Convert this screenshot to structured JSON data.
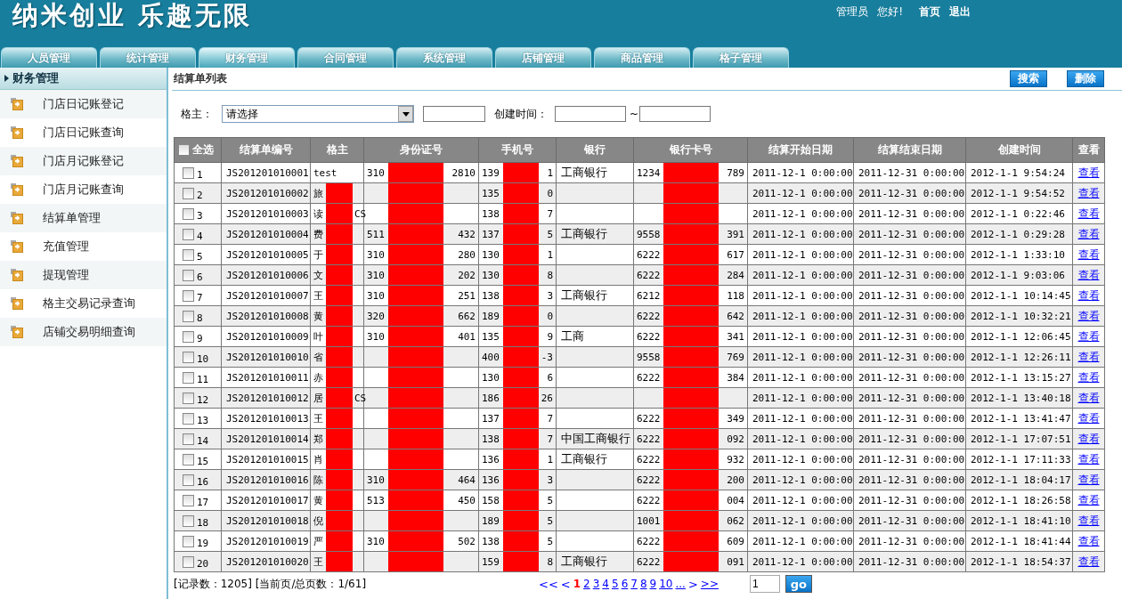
{
  "header": {
    "title": "纳米创业 乐趣无限",
    "user_label": "管理员",
    "greeting": "您好!",
    "links": [
      "首页",
      "退出"
    ]
  },
  "tabs": [
    {
      "label": "人员管理",
      "selected": false
    },
    {
      "label": "统计管理",
      "selected": false
    },
    {
      "label": "财务管理",
      "selected": true
    },
    {
      "label": "合同管理",
      "selected": false
    },
    {
      "label": "系统管理",
      "selected": false
    },
    {
      "label": "店铺管理",
      "selected": false
    },
    {
      "label": "商品管理",
      "selected": false
    },
    {
      "label": "格子管理",
      "selected": false
    }
  ],
  "sidebar": {
    "heading": "财务管理",
    "items": [
      {
        "label": "门店日记账登记",
        "selected": false
      },
      {
        "label": "门店日记账查询",
        "selected": false
      },
      {
        "label": "门店月记账登记",
        "selected": false
      },
      {
        "label": "门店月记账查询",
        "selected": false
      },
      {
        "label": "结算单管理",
        "selected": false
      },
      {
        "label": "充值管理",
        "selected": false
      },
      {
        "label": "提现管理",
        "selected": false
      },
      {
        "label": "格主交易记录查询",
        "selected": false
      },
      {
        "label": "店铺交易明细查询",
        "selected": false
      }
    ]
  },
  "panel": {
    "title": "结算单列表",
    "buttons": [
      "搜索",
      "删除"
    ]
  },
  "filters": {
    "owner_label": "格主：",
    "owner_select": "请选择",
    "created_label": "创建时间：",
    "range_separator": "~"
  },
  "table": {
    "select_all": {
      "label": "全选",
      "checked": false
    },
    "columns": [
      "结算单编号",
      "格主",
      "身份证号",
      "手机号",
      "银行",
      "银行卡号",
      "结算开始日期",
      "结算结束日期",
      "创建时间",
      "查看"
    ],
    "rows": [
      {
        "no": "1",
        "checked": false,
        "code": "JS201201010001",
        "owner": {
          "start": "test",
          "redacted": false
        },
        "id_card": {
          "start": "310",
          "end": "2810",
          "redacted": true
        },
        "phone": {
          "start": "139",
          "end": "1",
          "redacted": true
        },
        "bank": "工商银行",
        "card": {
          "start": "1234",
          "end": "789",
          "redacted": true
        },
        "start": "2011-12-1 0:00:00",
        "end": "2011-12-31 0:00:00",
        "created": "2012-1-1 9:54:24",
        "view": "查看"
      },
      {
        "no": "2",
        "checked": false,
        "code": "JS201201010002",
        "owner": {
          "start": "旅",
          "redacted": true
        },
        "id_card": {
          "redacted": true
        },
        "phone": {
          "start": "135",
          "end": "0",
          "redacted": true
        },
        "card": {
          "redacted": true
        },
        "start": "2011-12-1 0:00:00",
        "end": "2011-12-31 0:00:00",
        "created": "2012-1-1 9:54:52",
        "view": "查看"
      },
      {
        "no": "3",
        "checked": false,
        "code": "JS201201010003",
        "owner": {
          "start": "读",
          "end": "CS",
          "redacted": true
        },
        "id_card": {
          "redacted": true
        },
        "phone": {
          "start": "138",
          "end": "7",
          "redacted": true
        },
        "card": {
          "redacted": true
        },
        "start": "2011-12-1 0:00:00",
        "end": "2011-12-31 0:00:00",
        "created": "2012-1-1 0:22:46",
        "view": "查看"
      },
      {
        "no": "4",
        "checked": false,
        "code": "JS201201010004",
        "owner": {
          "start": "费",
          "redacted": true
        },
        "id_card": {
          "start": "511",
          "end": "432",
          "redacted": true
        },
        "phone": {
          "start": "137",
          "end": "5",
          "redacted": true
        },
        "bank": "工商银行",
        "card": {
          "start": "9558",
          "end": "391",
          "redacted": true
        },
        "start": "2011-12-1 0:00:00",
        "end": "2011-12-31 0:00:00",
        "created": "2012-1-1 0:29:28",
        "view": "查看"
      },
      {
        "no": "5",
        "checked": false,
        "code": "JS201201010005",
        "owner": {
          "start": "于",
          "redacted": true
        },
        "id_card": {
          "start": "310",
          "end": "280",
          "redacted": true
        },
        "phone": {
          "start": "130",
          "end": "1",
          "redacted": true
        },
        "card": {
          "start": "6222",
          "end": "617",
          "redacted": true
        },
        "start": "2011-12-1 0:00:00",
        "end": "2011-12-31 0:00:00",
        "created": "2012-1-1 1:33:10",
        "view": "查看"
      },
      {
        "no": "6",
        "checked": false,
        "code": "JS201201010006",
        "owner": {
          "start": "文",
          "redacted": true
        },
        "id_card": {
          "start": "310",
          "end": "202",
          "redacted": true
        },
        "phone": {
          "start": "130",
          "end": "8",
          "redacted": true
        },
        "card": {
          "start": "6222",
          "end": "284",
          "redacted": true
        },
        "start": "2011-12-1 0:00:00",
        "end": "2011-12-31 0:00:00",
        "created": "2012-1-1 9:03:06",
        "view": "查看"
      },
      {
        "no": "7",
        "checked": false,
        "code": "JS201201010007",
        "owner": {
          "start": "王",
          "redacted": true
        },
        "id_card": {
          "start": "310",
          "end": "251",
          "redacted": true
        },
        "phone": {
          "start": "138",
          "end": "3",
          "redacted": true
        },
        "bank": "工商银行",
        "card": {
          "start": "6212",
          "end": "118",
          "redacted": true
        },
        "start": "2011-12-1 0:00:00",
        "end": "2011-12-31 0:00:00",
        "created": "2012-1-1 10:14:45",
        "view": "查看"
      },
      {
        "no": "8",
        "checked": false,
        "code": "JS201201010008",
        "owner": {
          "start": "黄",
          "redacted": true
        },
        "id_card": {
          "start": "320",
          "end": "662",
          "redacted": true
        },
        "phone": {
          "start": "189",
          "end": "0",
          "redacted": true
        },
        "card": {
          "start": "6222",
          "end": "642",
          "redacted": true
        },
        "start": "2011-12-1 0:00:00",
        "end": "2011-12-31 0:00:00",
        "created": "2012-1-1 10:32:21",
        "view": "查看"
      },
      {
        "no": "9",
        "checked": false,
        "code": "JS201201010009",
        "owner": {
          "start": "叶",
          "redacted": true
        },
        "id_card": {
          "start": "310",
          "end": "401",
          "redacted": true
        },
        "phone": {
          "start": "135",
          "end": "9",
          "redacted": true
        },
        "bank": "工商",
        "card": {
          "start": "6222",
          "end": "341",
          "redacted": true
        },
        "start": "2011-12-1 0:00:00",
        "end": "2011-12-31 0:00:00",
        "created": "2012-1-1 12:06:45",
        "view": "查看"
      },
      {
        "no": "10",
        "checked": false,
        "code": "JS201201010010",
        "owner": {
          "start": "省",
          "redacted": true
        },
        "id_card": {
          "redacted": true
        },
        "phone": {
          "start": "400",
          "end": "-3",
          "redacted": true
        },
        "card": {
          "start": "9558",
          "end": "769",
          "redacted": true
        },
        "start": "2011-12-1 0:00:00",
        "end": "2011-12-31 0:00:00",
        "created": "2012-1-1 12:26:11",
        "view": "查看"
      },
      {
        "no": "11",
        "checked": false,
        "code": "JS201201010011",
        "owner": {
          "start": "赤",
          "redacted": true
        },
        "id_card": {
          "redacted": true
        },
        "phone": {
          "start": "130",
          "end": "6",
          "redacted": true
        },
        "card": {
          "start": "6222",
          "end": "384",
          "redacted": true
        },
        "start": "2011-12-1 0:00:00",
        "end": "2011-12-31 0:00:00",
        "created": "2012-1-1 13:15:27",
        "view": "查看"
      },
      {
        "no": "12",
        "checked": false,
        "code": "JS201201010012",
        "owner": {
          "start": "居",
          "end": "CS",
          "redacted": true
        },
        "id_card": {
          "redacted": true
        },
        "phone": {
          "start": "186",
          "end": "26",
          "redacted": true
        },
        "card": {
          "redacted": true
        },
        "start": "2011-12-1 0:00:00",
        "end": "2011-12-31 0:00:00",
        "created": "2012-1-1 13:40:18",
        "view": "查看"
      },
      {
        "no": "13",
        "checked": false,
        "code": "JS201201010013",
        "owner": {
          "start": "王",
          "redacted": true
        },
        "id_card": {
          "redacted": true
        },
        "phone": {
          "start": "137",
          "end": "7",
          "redacted": true
        },
        "card": {
          "start": "6222",
          "end": "349",
          "redacted": true
        },
        "start": "2011-12-1 0:00:00",
        "end": "2011-12-31 0:00:00",
        "created": "2012-1-1 13:41:47",
        "view": "查看"
      },
      {
        "no": "14",
        "checked": false,
        "code": "JS201201010014",
        "owner": {
          "start": "郑",
          "redacted": true
        },
        "id_card": {
          "redacted": true
        },
        "phone": {
          "start": "138",
          "end": "7",
          "redacted": true
        },
        "bank": "中国工商银行",
        "card": {
          "start": "6222",
          "end": "092",
          "redacted": true
        },
        "start": "2011-12-1 0:00:00",
        "end": "2011-12-31 0:00:00",
        "created": "2012-1-1 17:07:51",
        "view": "查看"
      },
      {
        "no": "15",
        "checked": false,
        "code": "JS201201010015",
        "owner": {
          "start": "肖",
          "redacted": true
        },
        "id_card": {
          "redacted": true
        },
        "phone": {
          "start": "136",
          "end": "1",
          "redacted": true
        },
        "bank": "工商银行",
        "card": {
          "start": "6222",
          "end": "932",
          "redacted": true
        },
        "start": "2011-12-1 0:00:00",
        "end": "2011-12-31 0:00:00",
        "created": "2012-1-1 17:11:33",
        "view": "查看"
      },
      {
        "no": "16",
        "checked": false,
        "code": "JS201201010016",
        "owner": {
          "start": "陈",
          "redacted": true
        },
        "id_card": {
          "start": "310",
          "end": "464",
          "redacted": true
        },
        "phone": {
          "start": "136",
          "end": "3",
          "redacted": true
        },
        "card": {
          "start": "6222",
          "end": "200",
          "redacted": true
        },
        "start": "2011-12-1 0:00:00",
        "end": "2011-12-31 0:00:00",
        "created": "2012-1-1 18:04:17",
        "view": "查看"
      },
      {
        "no": "17",
        "checked": false,
        "code": "JS201201010017",
        "owner": {
          "start": "黄",
          "redacted": true
        },
        "id_card": {
          "start": "513",
          "end": "450",
          "redacted": true
        },
        "phone": {
          "start": "158",
          "end": "5",
          "redacted": true
        },
        "card": {
          "start": "6222",
          "end": "004",
          "redacted": true
        },
        "start": "2011-12-1 0:00:00",
        "end": "2011-12-31 0:00:00",
        "created": "2012-1-1 18:26:58",
        "view": "查看"
      },
      {
        "no": "18",
        "checked": false,
        "code": "JS201201010018",
        "owner": {
          "start": "倪",
          "redacted": true
        },
        "id_card": {
          "redacted": true
        },
        "phone": {
          "start": "189",
          "end": "5",
          "redacted": true
        },
        "card": {
          "start": "1001",
          "end": "062",
          "redacted": true
        },
        "start": "2011-12-1 0:00:00",
        "end": "2011-12-31 0:00:00",
        "created": "2012-1-1 18:41:10",
        "view": "查看"
      },
      {
        "no": "19",
        "checked": false,
        "code": "JS201201010019",
        "owner": {
          "start": "严",
          "redacted": true
        },
        "id_card": {
          "start": "310",
          "end": "502",
          "redacted": true
        },
        "phone": {
          "start": "138",
          "end": "5",
          "redacted": true
        },
        "card": {
          "start": "6222",
          "end": "609",
          "redacted": true
        },
        "start": "2011-12-1 0:00:00",
        "end": "2011-12-31 0:00:00",
        "created": "2012-1-1 18:41:44",
        "view": "查看"
      },
      {
        "no": "20",
        "checked": false,
        "code": "JS201201010020",
        "owner": {
          "start": "王",
          "redacted": true
        },
        "id_card": {
          "redacted": true
        },
        "phone": {
          "start": "159",
          "end": "8",
          "redacted": true
        },
        "bank": "工商银行",
        "card": {
          "start": "6222",
          "end": "091",
          "redacted": true
        },
        "start": "2011-12-1 0:00:00",
        "end": "2011-12-31 0:00:00",
        "created": "2012-1-1 18:54:37",
        "view": "查看"
      }
    ]
  },
  "footer": {
    "summary": "[记录数：1205] [当前页/总页数：1/61]",
    "pager": [
      {
        "label": "<<",
        "kind": "arrow",
        "selected": false
      },
      {
        "label": "<",
        "kind": "arrow",
        "selected": false
      },
      {
        "label": "1",
        "kind": "page",
        "selected": true
      },
      {
        "label": "2",
        "kind": "page",
        "selected": false
      },
      {
        "label": "3",
        "kind": "page",
        "selected": false
      },
      {
        "label": "4",
        "kind": "page",
        "selected": false
      },
      {
        "label": "5",
        "kind": "page",
        "selected": false
      },
      {
        "label": "6",
        "kind": "page",
        "selected": false
      },
      {
        "label": "7",
        "kind": "page",
        "selected": false
      },
      {
        "label": "8",
        "kind": "page",
        "selected": false
      },
      {
        "label": "9",
        "kind": "page",
        "selected": false
      },
      {
        "label": "10",
        "kind": "page",
        "selected": false
      },
      {
        "label": "...",
        "kind": "page",
        "selected": false
      },
      {
        "label": ">",
        "kind": "arrow",
        "selected": false
      },
      {
        "label": ">>",
        "kind": "page",
        "selected": false
      }
    ],
    "page_input": "1",
    "go_button": "go"
  }
}
